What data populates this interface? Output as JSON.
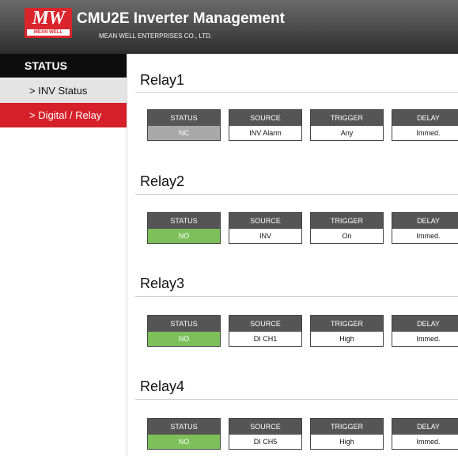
{
  "header": {
    "logo_mark": "MW",
    "logo_sub": "MEAN WELL",
    "title": "CMU2E Inverter Management",
    "subtitle": "MEAN WELL ENTERPRISES CO., LTD."
  },
  "sidebar": {
    "heading": "STATUS",
    "items": [
      {
        "label": "> INV Status"
      },
      {
        "label": "> Digital / Relay"
      }
    ]
  },
  "columns": [
    "STATUS",
    "SOURCE",
    "TRIGGER",
    "DELAY"
  ],
  "status_colors": {
    "NC": "#a9a9a9",
    "NO": "#7dc05a"
  },
  "relays": [
    {
      "title": "Relay1",
      "status": "NC",
      "source": "INV Alarm",
      "trigger": "Any",
      "delay": "Immed."
    },
    {
      "title": "Relay2",
      "status": "NO",
      "source": "INV",
      "trigger": "On",
      "delay": "Immed."
    },
    {
      "title": "Relay3",
      "status": "NO",
      "source": "DI CH1",
      "trigger": "High",
      "delay": "Immed."
    },
    {
      "title": "Relay4",
      "status": "NO",
      "source": "DI CH5",
      "trigger": "High",
      "delay": "Immed."
    }
  ]
}
